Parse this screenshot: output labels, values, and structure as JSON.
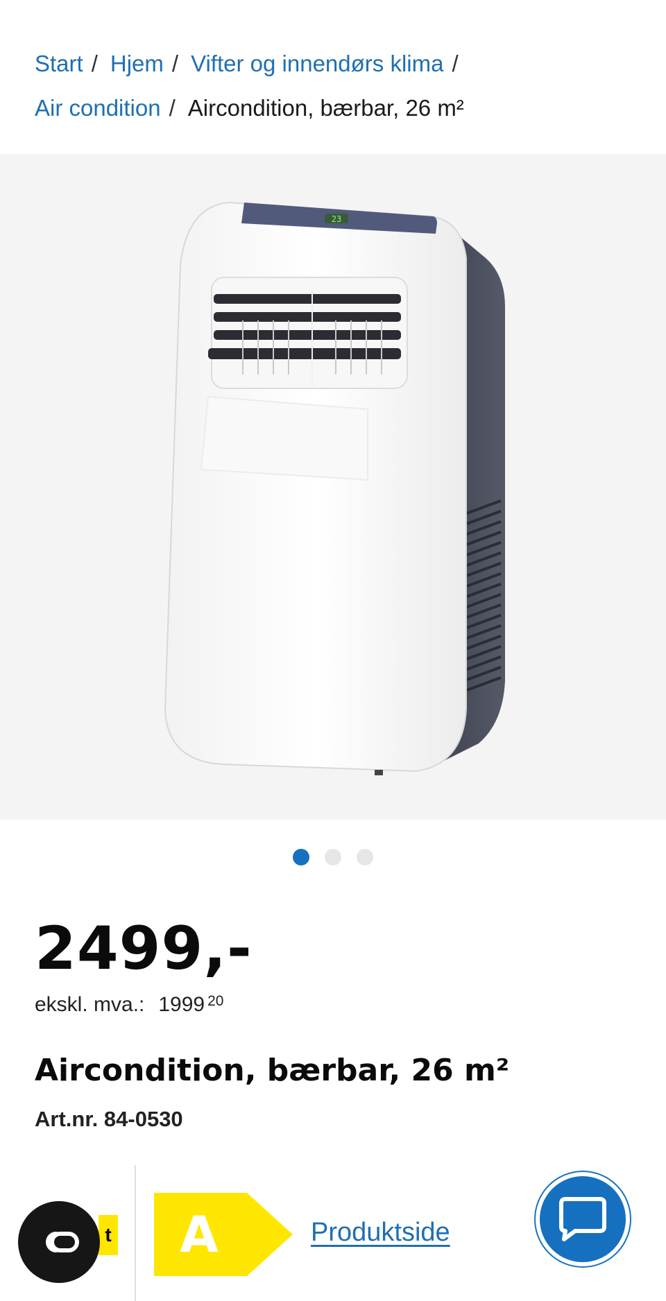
{
  "breadcrumb": {
    "items": [
      {
        "label": "Start"
      },
      {
        "label": "Hjem"
      },
      {
        "label": "Vifter og innendørs klima"
      },
      {
        "label": "Air condition"
      }
    ],
    "separator": "/",
    "current": "Aircondition, bærbar, 26 m²"
  },
  "gallery": {
    "slide_count": 3,
    "active_index": 0,
    "display_readout": "23"
  },
  "product": {
    "price": "2499,-",
    "excl_vat_label": "ekskl. mva.:",
    "excl_vat_whole": "1999",
    "excl_vat_cents": "20",
    "title": "Aircondition, bærbar, 26 m²",
    "article_number": "Art.nr. 84-0530"
  },
  "bottom": {
    "partial_tab_text": "t",
    "energy_class": "A",
    "product_sheet_link": "Produktside"
  },
  "colors": {
    "link": "#1f6fb2",
    "accent": "#1670c0",
    "energy_yellow": "#ffe600"
  },
  "icons": {
    "co_button": "co-logo-icon",
    "chat_button": "chat-bubble-icon"
  }
}
